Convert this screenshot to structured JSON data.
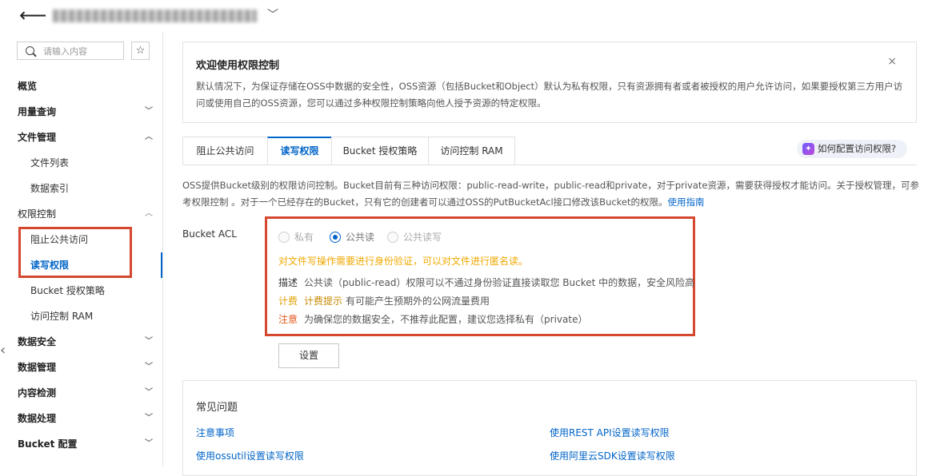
{
  "header": {
    "back_icon": "arrow-left-icon",
    "caret_icon": "chevron-down-icon"
  },
  "sidebar": {
    "search_placeholder": "请输入内容",
    "items": [
      {
        "label": "概览",
        "level": "group",
        "chevron": ""
      },
      {
        "label": "用量查询",
        "level": "group",
        "chevron": "﹀"
      },
      {
        "label": "文件管理",
        "level": "group",
        "chevron": "︿"
      },
      {
        "label": "文件列表",
        "level": "sub",
        "chevron": ""
      },
      {
        "label": "数据索引",
        "level": "sub",
        "chevron": ""
      },
      {
        "label": "权限控制",
        "level": "group-plain",
        "chevron": "︿"
      },
      {
        "label": "阻止公共访问",
        "level": "sub",
        "chevron": ""
      },
      {
        "label": "读写权限",
        "level": "sub-active",
        "chevron": ""
      },
      {
        "label": "Bucket 授权策略",
        "level": "sub",
        "chevron": ""
      },
      {
        "label": "访问控制 RAM",
        "level": "sub",
        "chevron": ""
      },
      {
        "label": "数据安全",
        "level": "group",
        "chevron": "﹀"
      },
      {
        "label": "数据管理",
        "level": "group",
        "chevron": "﹀"
      },
      {
        "label": "内容检测",
        "level": "group",
        "chevron": "﹀"
      },
      {
        "label": "数据处理",
        "level": "group",
        "chevron": "﹀"
      },
      {
        "label": "Bucket 配置",
        "level": "group",
        "chevron": "﹀"
      }
    ]
  },
  "welcome": {
    "title": "欢迎使用权限控制",
    "close": "×",
    "body": "默认情况下，为保证存储在OSS中数据的安全性，OSS资源（包括Bucket和Object）默认为私有权限，只有资源拥有者或者被授权的用户允许访问，如果要授权第三方用户访问或使用自己的OSS资源，您可以通过多种权限控制策略向他人授予资源的特定权限。"
  },
  "tabs": [
    {
      "label": "阻止公共访问",
      "active": false
    },
    {
      "label": "读写权限",
      "active": true
    },
    {
      "label": "Bucket 授权策略",
      "active": false
    },
    {
      "label": "访问控制 RAM",
      "active": false
    }
  ],
  "help_pill": "如何配置访问权限?",
  "description": {
    "text": "OSS提供Bucket级别的权限访问控制。Bucket目前有三种访问权限：public-read-write，public-read和private，对于private资源，需要获得授权才能访问。关于授权管理，可参考权限控制 。对于一个已经存在的Bucket，只有它的创建者可以通过OSS的PutBucketAcl接口修改该Bucket的权限。",
    "link": "使用指南"
  },
  "acl": {
    "label": "Bucket ACL",
    "options": [
      {
        "label": "私有",
        "checked": false
      },
      {
        "label": "公共读",
        "checked": true
      },
      {
        "label": "公共读写",
        "checked": false
      }
    ],
    "warning": "对文件写操作需要进行身份验证，可以对文件进行匿名读。",
    "desc_key": "描述",
    "desc_val": "公共读（public-read）权限可以不通过身份验证直接读取您 Bucket 中的数据，安全风险高",
    "billing_key": "计费",
    "billing_key2": "计费提示",
    "billing_val": "有可能产生预期外的公网流量费用",
    "note_key": "注意",
    "note_val": "为确保您的数据安全，不推荐此配置，建议您选择私有（private）",
    "save_label": "设置"
  },
  "faq": {
    "title": "常见问题",
    "links": [
      "注意事项",
      "使用REST API设置读写权限",
      "使用ossutil设置读写权限",
      "使用阿里云SDK设置读写权限"
    ]
  },
  "colors": {
    "accent": "#0064c8",
    "highlight": "#d5472f",
    "warning": "#f0a800"
  }
}
